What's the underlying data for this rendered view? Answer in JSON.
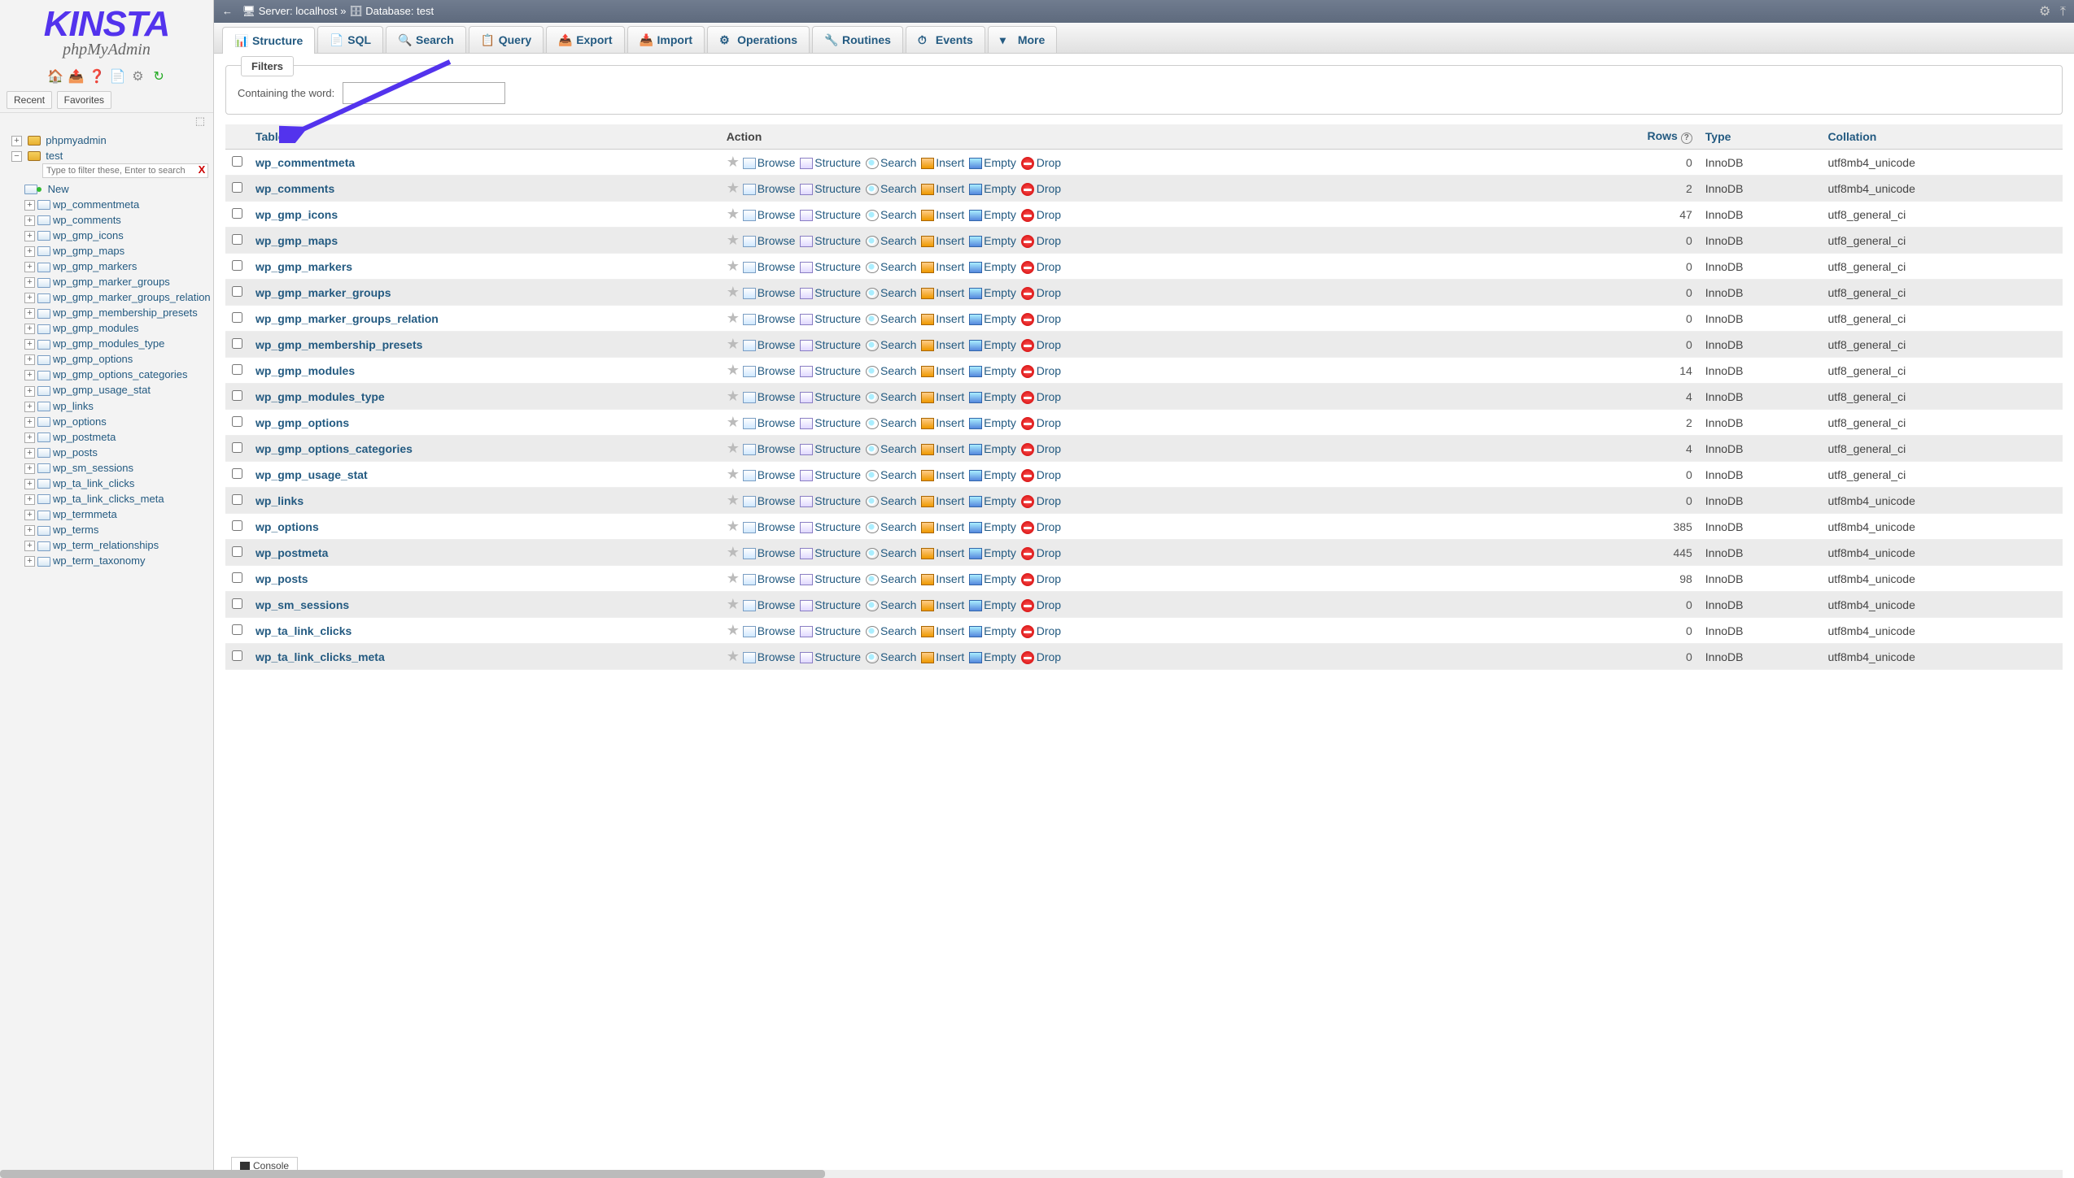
{
  "logo": {
    "brand": "KINSTA",
    "sub": "phpMyAdmin"
  },
  "sidebar": {
    "recent": "Recent",
    "favorites": "Favorites",
    "filter_placeholder": "Type to filter these, Enter to search",
    "root": "phpmyadmin",
    "db": "test",
    "new": "New",
    "tables": [
      "wp_commentmeta",
      "wp_comments",
      "wp_gmp_icons",
      "wp_gmp_maps",
      "wp_gmp_markers",
      "wp_gmp_marker_groups",
      "wp_gmp_marker_groups_relation",
      "wp_gmp_membership_presets",
      "wp_gmp_modules",
      "wp_gmp_modules_type",
      "wp_gmp_options",
      "wp_gmp_options_categories",
      "wp_gmp_usage_stat",
      "wp_links",
      "wp_options",
      "wp_postmeta",
      "wp_posts",
      "wp_sm_sessions",
      "wp_ta_link_clicks",
      "wp_ta_link_clicks_meta",
      "wp_termmeta",
      "wp_terms",
      "wp_term_relationships",
      "wp_term_taxonomy"
    ]
  },
  "breadcrumb": {
    "server_label": "Server:",
    "server": "localhost",
    "db_label": "Database:",
    "db": "test"
  },
  "tabs": [
    "Structure",
    "SQL",
    "Search",
    "Query",
    "Export",
    "Import",
    "Operations",
    "Routines",
    "Events",
    "More"
  ],
  "filters": {
    "legend": "Filters",
    "label": "Containing the word:"
  },
  "headers": {
    "table": "Table",
    "action": "Action",
    "rows": "Rows",
    "type": "Type",
    "collation": "Collation"
  },
  "actions": {
    "browse": "Browse",
    "structure": "Structure",
    "search": "Search",
    "insert": "Insert",
    "empty": "Empty",
    "drop": "Drop"
  },
  "console": "Console",
  "rows": [
    {
      "name": "wp_commentmeta",
      "rows": "0",
      "type": "InnoDB",
      "collation": "utf8mb4_unicode"
    },
    {
      "name": "wp_comments",
      "rows": "2",
      "type": "InnoDB",
      "collation": "utf8mb4_unicode"
    },
    {
      "name": "wp_gmp_icons",
      "rows": "47",
      "type": "InnoDB",
      "collation": "utf8_general_ci"
    },
    {
      "name": "wp_gmp_maps",
      "rows": "0",
      "type": "InnoDB",
      "collation": "utf8_general_ci"
    },
    {
      "name": "wp_gmp_markers",
      "rows": "0",
      "type": "InnoDB",
      "collation": "utf8_general_ci"
    },
    {
      "name": "wp_gmp_marker_groups",
      "rows": "0",
      "type": "InnoDB",
      "collation": "utf8_general_ci"
    },
    {
      "name": "wp_gmp_marker_groups_relation",
      "rows": "0",
      "type": "InnoDB",
      "collation": "utf8_general_ci"
    },
    {
      "name": "wp_gmp_membership_presets",
      "rows": "0",
      "type": "InnoDB",
      "collation": "utf8_general_ci"
    },
    {
      "name": "wp_gmp_modules",
      "rows": "14",
      "type": "InnoDB",
      "collation": "utf8_general_ci"
    },
    {
      "name": "wp_gmp_modules_type",
      "rows": "4",
      "type": "InnoDB",
      "collation": "utf8_general_ci"
    },
    {
      "name": "wp_gmp_options",
      "rows": "2",
      "type": "InnoDB",
      "collation": "utf8_general_ci"
    },
    {
      "name": "wp_gmp_options_categories",
      "rows": "4",
      "type": "InnoDB",
      "collation": "utf8_general_ci"
    },
    {
      "name": "wp_gmp_usage_stat",
      "rows": "0",
      "type": "InnoDB",
      "collation": "utf8_general_ci"
    },
    {
      "name": "wp_links",
      "rows": "0",
      "type": "InnoDB",
      "collation": "utf8mb4_unicode"
    },
    {
      "name": "wp_options",
      "rows": "385",
      "type": "InnoDB",
      "collation": "utf8mb4_unicode"
    },
    {
      "name": "wp_postmeta",
      "rows": "445",
      "type": "InnoDB",
      "collation": "utf8mb4_unicode"
    },
    {
      "name": "wp_posts",
      "rows": "98",
      "type": "InnoDB",
      "collation": "utf8mb4_unicode"
    },
    {
      "name": "wp_sm_sessions",
      "rows": "0",
      "type": "InnoDB",
      "collation": "utf8mb4_unicode"
    },
    {
      "name": "wp_ta_link_clicks",
      "rows": "0",
      "type": "InnoDB",
      "collation": "utf8mb4_unicode"
    },
    {
      "name": "wp_ta_link_clicks_meta",
      "rows": "0",
      "type": "InnoDB",
      "collation": "utf8mb4_unicode"
    }
  ]
}
